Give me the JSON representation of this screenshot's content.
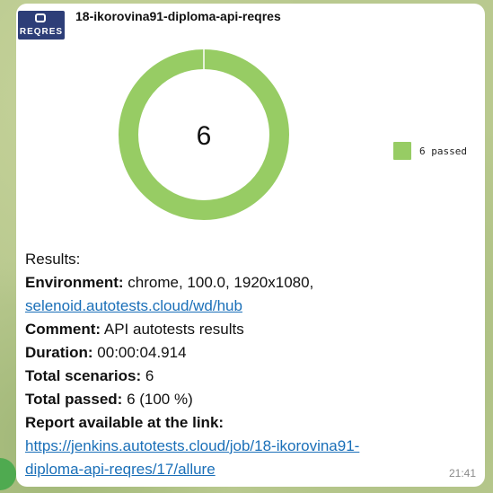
{
  "header": {
    "logo_text": "REQRES",
    "title": "18-ikorovina91-diploma-api-reqres"
  },
  "chart_data": {
    "type": "pie",
    "center_label": "6",
    "slices": [
      {
        "name": "passed",
        "value": 6,
        "color": "#97cc64"
      }
    ],
    "legend": [
      "6 passed"
    ],
    "legend_position": "right"
  },
  "message": {
    "results_label": "Results:",
    "environment_label": "Environment:",
    "environment_value": "chrome, 100.0, 1920x1080,",
    "environment_link": "selenoid.autotests.cloud/wd/hub",
    "comment_label": "Comment:",
    "comment_value": "API autotests results",
    "duration_label": "Duration:",
    "duration_value": "00:00:04.914",
    "scenarios_label": "Total scenarios:",
    "scenarios_value": "6",
    "passed_label": "Total passed:",
    "passed_value": "6 (100 %)",
    "report_label": "Report available at the link:",
    "report_link_line1": "https://jenkins.autotests.cloud/job/18-ikorovina91-",
    "report_link_line2": "diploma-api-reqres/17/allure"
  },
  "timestamp": "21:41"
}
